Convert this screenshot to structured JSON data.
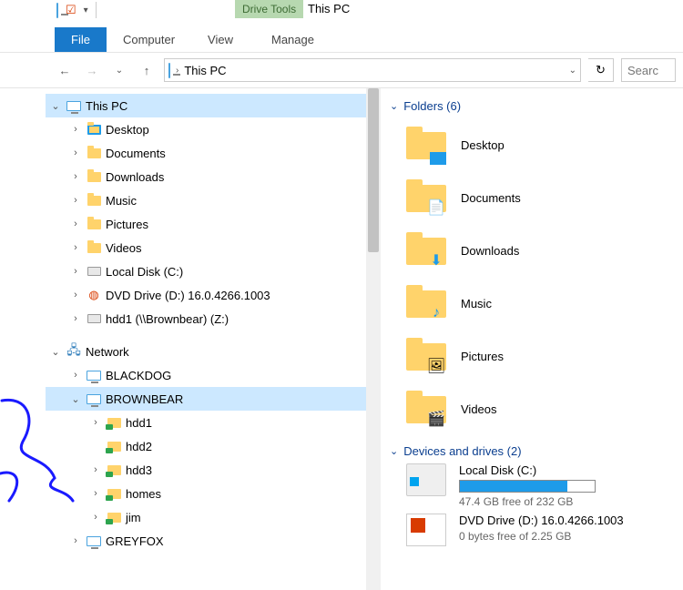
{
  "window": {
    "title": "This PC",
    "contextual_tab": "Drive Tools"
  },
  "tabs": {
    "file": "File",
    "computer": "Computer",
    "view": "View",
    "manage": "Manage"
  },
  "address": {
    "location": "This PC",
    "search_placeholder": "Searc"
  },
  "tree": {
    "root": "This PC",
    "items": [
      {
        "label": "Desktop"
      },
      {
        "label": "Documents"
      },
      {
        "label": "Downloads"
      },
      {
        "label": "Music"
      },
      {
        "label": "Pictures"
      },
      {
        "label": "Videos"
      },
      {
        "label": "Local Disk (C:)"
      },
      {
        "label": "DVD Drive (D:) 16.0.4266.1003"
      },
      {
        "label": "hdd1 (\\\\Brownbear) (Z:)"
      }
    ],
    "network": {
      "label": "Network",
      "hosts": [
        {
          "label": "BLACKDOG"
        },
        {
          "label": "BROWNBEAR",
          "expanded": true,
          "shares": [
            "hdd1",
            "hdd2",
            "hdd3",
            "homes",
            "jim"
          ]
        },
        {
          "label": "GREYFOX"
        }
      ]
    }
  },
  "content": {
    "folders_header": "Folders (6)",
    "folders": [
      "Desktop",
      "Documents",
      "Downloads",
      "Music",
      "Pictures",
      "Videos"
    ],
    "drives_header": "Devices and drives (2)",
    "drives": [
      {
        "name": "Local Disk (C:)",
        "free_text": "47.4 GB free of 232 GB",
        "fill_pct": 80
      },
      {
        "name": "DVD Drive (D:) 16.0.4266.1003",
        "free_text": "0 bytes free of 2.25 GB"
      }
    ]
  }
}
